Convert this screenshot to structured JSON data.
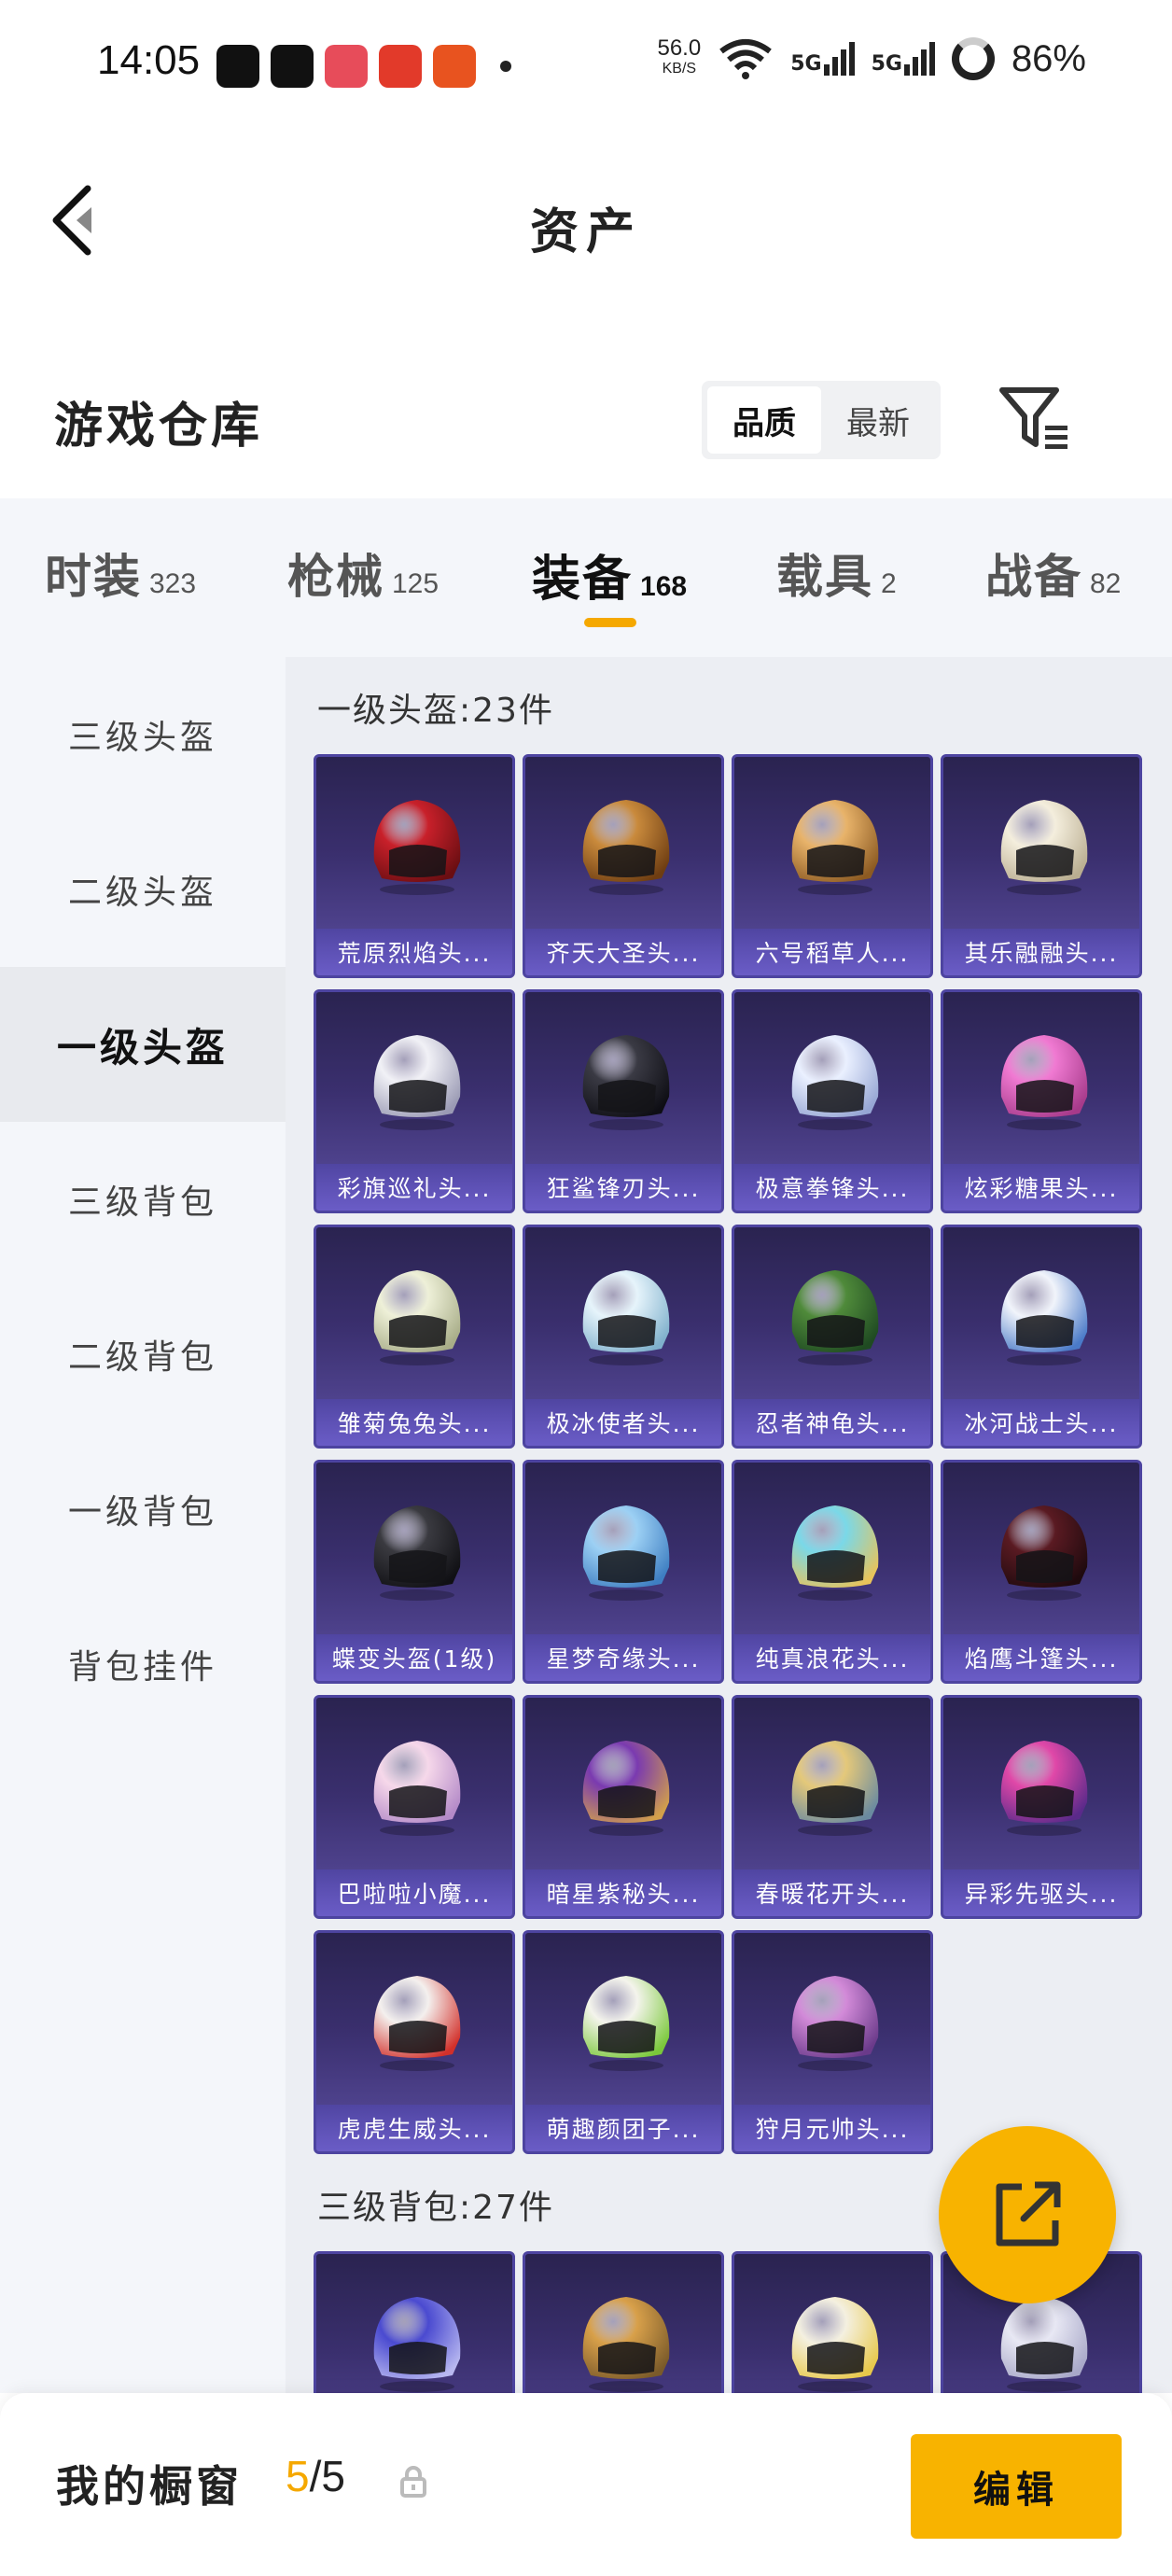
{
  "status_bar": {
    "time": "14:05",
    "net_speed": "56.0",
    "net_unit": "KB/S",
    "signal_1": "5G",
    "signal_2": "5G",
    "battery": "86%",
    "apps": [
      {
        "icon": "douyin-icon",
        "color": "#111111"
      },
      {
        "icon": "news-icon",
        "color": "#111111"
      },
      {
        "icon": "game-app-icon",
        "color": "#e74c5a"
      },
      {
        "icon": "shop-app-icon",
        "color": "#e23a2a"
      },
      {
        "icon": "robot-app-icon",
        "color": "#e8531f"
      }
    ]
  },
  "header": {
    "title": "资产",
    "back_icon": "chevron-left-icon"
  },
  "warehouse": {
    "title": "游戏仓库",
    "sort_options": [
      "品质",
      "最新"
    ],
    "sort_active": "品质",
    "filter_icon": "filter-icon"
  },
  "category_tabs": [
    {
      "label": "时装",
      "count": "323"
    },
    {
      "label": "枪械",
      "count": "125"
    },
    {
      "label": "装备",
      "count": "168",
      "active": true
    },
    {
      "label": "载具",
      "count": "2"
    },
    {
      "label": "战备",
      "count": "82"
    }
  ],
  "sidebar": [
    {
      "label": "三级头盔"
    },
    {
      "label": "二级头盔"
    },
    {
      "label": "一级头盔",
      "active": true
    },
    {
      "label": "三级背包"
    },
    {
      "label": "二级背包"
    },
    {
      "label": "一级背包"
    },
    {
      "label": "背包挂件"
    }
  ],
  "sections": [
    {
      "title": "一级头盔:23件",
      "items": [
        {
          "name": "荒原烈焰头...",
          "c1": "#c8202a",
          "c2": "#6a0e12"
        },
        {
          "name": "齐天大圣头...",
          "c1": "#c98a3c",
          "c2": "#6e3d12"
        },
        {
          "name": "六号稻草人...",
          "c1": "#e8b36a",
          "c2": "#8c5a22"
        },
        {
          "name": "其乐融融头...",
          "c1": "#f4eedd",
          "c2": "#b9ad90"
        },
        {
          "name": "彩旗巡礼头...",
          "c1": "#f1f1f6",
          "c2": "#9a9ab4"
        },
        {
          "name": "狂鲨锋刃头...",
          "c1": "#3a3a44",
          "c2": "#0e0e14"
        },
        {
          "name": "极意拳锋头...",
          "c1": "#eaf0ff",
          "c2": "#96a6d4"
        },
        {
          "name": "炫彩糖果头...",
          "c1": "#f07ad2",
          "c2": "#a63a8a"
        },
        {
          "name": "雏菊兔兔头...",
          "c1": "#eef0d8",
          "c2": "#a8ad88"
        },
        {
          "name": "极冰使者头...",
          "c1": "#e6f4fb",
          "c2": "#7fb0cc"
        },
        {
          "name": "忍者神龟头...",
          "c1": "#4f8a3a",
          "c2": "#1f4a22"
        },
        {
          "name": "冰河战士头...",
          "c1": "#f1f4fb",
          "c2": "#4a7ac8"
        },
        {
          "name": "蝶变头盔(1级)",
          "c1": "#3a3a40",
          "c2": "#101014"
        },
        {
          "name": "星梦奇缘头...",
          "c1": "#9cd0f4",
          "c2": "#3e7ec2"
        },
        {
          "name": "纯真浪花头...",
          "c1": "#7ad8e8",
          "c2": "#e8c35a"
        },
        {
          "name": "焰鹰斗篷头...",
          "c1": "#5a1a22",
          "c2": "#1e0a0e"
        },
        {
          "name": "巴啦啦小魔...",
          "c1": "#f6d8ea",
          "c2": "#b48ac8"
        },
        {
          "name": "暗星紫秘头...",
          "c1": "#7a3ab0",
          "c2": "#d2a04a"
        },
        {
          "name": "春暖花开头...",
          "c1": "#e4c87a",
          "c2": "#6a8aa0"
        },
        {
          "name": "异彩先驱头...",
          "c1": "#e048a8",
          "c2": "#5a2a8a"
        },
        {
          "name": "虎虎生威头...",
          "c1": "#f4f0ee",
          "c2": "#d2302a"
        },
        {
          "name": "萌趣颜团子...",
          "c1": "#f4f4ec",
          "c2": "#7ac83a"
        },
        {
          "name": "狩月元帅头...",
          "c1": "#d28ad8",
          "c2": "#6a3a8a"
        }
      ]
    },
    {
      "title": "三级背包:27件",
      "items": [
        {
          "name": "",
          "c1": "#4a4ad0",
          "c2": "#b8b8f0"
        },
        {
          "name": "",
          "c1": "#d8a04a",
          "c2": "#7a5a2a"
        },
        {
          "name": "",
          "c1": "#f4f0e0",
          "c2": "#e8c84a"
        },
        {
          "name": "",
          "c1": "#e8e8f4",
          "c2": "#a8a8c8"
        }
      ]
    }
  ],
  "share_icon": "share-external-icon",
  "bottom_bar": {
    "label": "我的橱窗",
    "count_current": "5",
    "count_sep": "/",
    "count_total": "5",
    "lock_icon": "lock-icon",
    "edit_label": "编辑"
  }
}
